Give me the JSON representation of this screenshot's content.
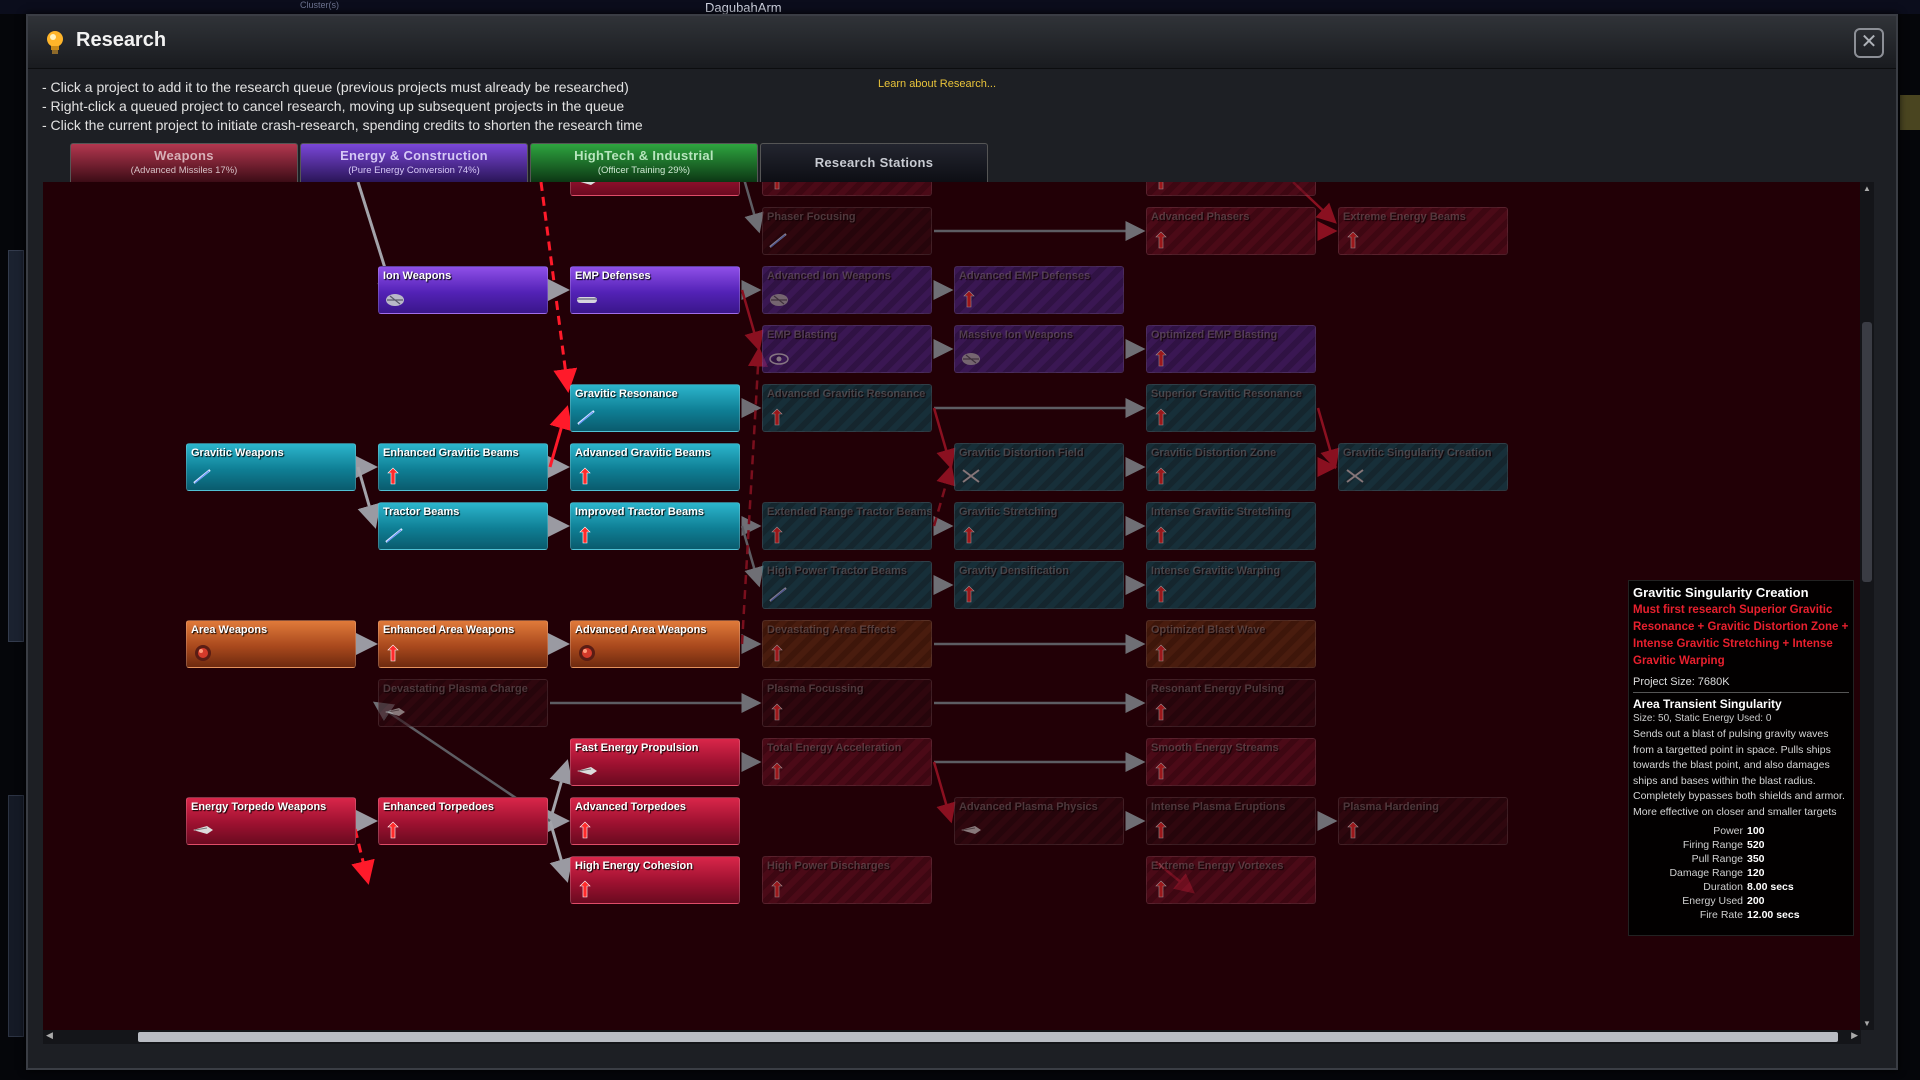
{
  "background": {
    "label_a": "Cluster(s)",
    "label_b": "DagubahArm"
  },
  "window": {
    "title": "Research",
    "close_glyph": "✕"
  },
  "instructions": [
    "- Click a project to add it to the research queue (previous projects must already be researched)",
    "- Right-click a queued project to cancel research, moving up subsequent projects in the queue",
    "- Click the current project to initiate crash-research, spending credits to shorten the research time"
  ],
  "learn_link": "Learn about Research...",
  "tabs": [
    {
      "label": "Weapons",
      "sub": "(Advanced Missiles 17%)"
    },
    {
      "label": "Energy & Construction",
      "sub": "(Pure Energy Conversion 74%)"
    },
    {
      "label": "HighTech & Industrial",
      "sub": "(Officer Training 29%)"
    },
    {
      "label": "Research Stations",
      "sub": ""
    }
  ],
  "nodes": [
    {
      "id": "top-red",
      "label": "",
      "color": "red",
      "state": "active",
      "icon": "torpedo-icon"
    },
    {
      "id": "top-col3",
      "label": "",
      "color": "red",
      "state": "locked",
      "icon": "arrow-icon"
    },
    {
      "id": "top-col5",
      "label": "",
      "color": "red",
      "state": "locked",
      "icon": "arrow-icon"
    },
    {
      "id": "phaser-focusing",
      "label": "Phaser Focusing",
      "color": "dark",
      "state": "locked",
      "icon": "beam-icon"
    },
    {
      "id": "advanced-phasers",
      "label": "Advanced Phasers",
      "color": "red",
      "state": "locked",
      "icon": "arrow-icon"
    },
    {
      "id": "extreme-energy-beams",
      "label": "Extreme Energy Beams",
      "color": "red",
      "state": "locked",
      "icon": "arrow-icon"
    },
    {
      "id": "ion-weapons",
      "label": "Ion Weapons",
      "color": "purple",
      "state": "active",
      "icon": "ion-icon"
    },
    {
      "id": "emp-defenses",
      "label": "EMP Defenses",
      "color": "purple",
      "state": "active",
      "icon": "emp-icon"
    },
    {
      "id": "advanced-ion-weapons",
      "label": "Advanced Ion Weapons",
      "color": "purple",
      "state": "locked",
      "icon": "ion-icon"
    },
    {
      "id": "advanced-emp-defenses",
      "label": "Advanced EMP Defenses",
      "color": "purple",
      "state": "locked",
      "icon": "arrow-icon"
    },
    {
      "id": "emp-blasting",
      "label": "EMP Blasting",
      "color": "purple",
      "state": "locked",
      "icon": "blast-icon"
    },
    {
      "id": "massive-ion-weapons",
      "label": "Massive Ion Weapons",
      "color": "purple",
      "state": "locked",
      "icon": "ion-icon"
    },
    {
      "id": "optimized-emp-blasting",
      "label": "Optimized EMP Blasting",
      "color": "purple",
      "state": "locked",
      "icon": "arrow-icon"
    },
    {
      "id": "gravitic-resonance",
      "label": "Gravitic Resonance",
      "color": "teal",
      "state": "active",
      "icon": "beam-icon"
    },
    {
      "id": "advanced-gravitic-resonance",
      "label": "Advanced Gravitic Resonance",
      "color": "teal",
      "state": "locked",
      "icon": "arrow-icon"
    },
    {
      "id": "superior-gravitic-resonance",
      "label": "Superior Gravitic Resonance",
      "color": "teal",
      "state": "locked",
      "icon": "arrow-icon"
    },
    {
      "id": "gravitic-weapons",
      "label": "Gravitic Weapons",
      "color": "teal",
      "state": "active",
      "icon": "beam-icon"
    },
    {
      "id": "enhanced-gravitic-beams",
      "label": "Enhanced Gravitic Beams",
      "color": "teal",
      "state": "active",
      "icon": "arrow-icon"
    },
    {
      "id": "advanced-gravitic-beams",
      "label": "Advanced Gravitic Beams",
      "color": "teal",
      "state": "active",
      "icon": "arrow-icon"
    },
    {
      "id": "gravitic-distortion-field",
      "label": "Gravitic Distortion Field",
      "color": "teal",
      "state": "locked",
      "icon": "cross-icon"
    },
    {
      "id": "gravitic-distortion-zone",
      "label": "Gravitic Distortion Zone",
      "color": "teal",
      "state": "locked",
      "icon": "arrow-icon"
    },
    {
      "id": "gravitic-singularity-creation",
      "label": "Gravitic Singularity Creation",
      "color": "teal",
      "state": "locked",
      "icon": "cross-icon"
    },
    {
      "id": "tractor-beams",
      "label": "Tractor Beams",
      "color": "teal",
      "state": "active",
      "icon": "beam-icon"
    },
    {
      "id": "improved-tractor-beams",
      "label": "Improved Tractor Beams",
      "color": "teal",
      "state": "active",
      "icon": "arrow-icon"
    },
    {
      "id": "extended-range-tractor-beams",
      "label": "Extended Range Tractor Beams",
      "color": "teal",
      "state": "locked",
      "icon": "arrow-icon"
    },
    {
      "id": "gravitic-stretching",
      "label": "Gravitic Stretching",
      "color": "teal",
      "state": "locked",
      "icon": "arrow-icon"
    },
    {
      "id": "intense-gravitic-stretching",
      "label": "Intense Gravitic Stretching",
      "color": "teal",
      "state": "locked",
      "icon": "arrow-icon"
    },
    {
      "id": "high-power-tractor-beams",
      "label": "High Power Tractor Beams",
      "color": "teal",
      "state": "locked",
      "icon": "beam-icon"
    },
    {
      "id": "gravity-densification",
      "label": "Gravity Densification",
      "color": "teal",
      "state": "locked",
      "icon": "arrow-icon"
    },
    {
      "id": "intense-gravitic-warping",
      "label": "Intense Gravitic Warping",
      "color": "teal",
      "state": "locked",
      "icon": "arrow-icon"
    },
    {
      "id": "area-weapons",
      "label": "Area Weapons",
      "color": "orange",
      "state": "active",
      "icon": "area-icon"
    },
    {
      "id": "enhanced-area-weapons",
      "label": "Enhanced Area Weapons",
      "color": "orange",
      "state": "active",
      "icon": "arrow-icon"
    },
    {
      "id": "advanced-area-weapons",
      "label": "Advanced Area Weapons",
      "color": "orange",
      "state": "active",
      "icon": "area-icon"
    },
    {
      "id": "devastating-area-effects",
      "label": "Devastating Area Effects",
      "color": "orange",
      "state": "locked",
      "icon": "arrow-icon"
    },
    {
      "id": "optimized-blast-wave",
      "label": "Optimized Blast Wave",
      "color": "orange",
      "state": "locked",
      "icon": "arrow-icon"
    },
    {
      "id": "devastating-plasma-charge",
      "label": "Devastating Plasma Charge",
      "color": "dark",
      "state": "locked",
      "icon": "torpedo-icon"
    },
    {
      "id": "plasma-focussing",
      "label": "Plasma Focussing",
      "color": "dark",
      "state": "locked",
      "icon": "arrow-icon"
    },
    {
      "id": "resonant-energy-pulsing",
      "label": "Resonant Energy Pulsing",
      "color": "dark",
      "state": "locked",
      "icon": "arrow-icon"
    },
    {
      "id": "fast-energy-propulsion",
      "label": "Fast Energy Propulsion",
      "color": "red",
      "state": "active",
      "icon": "torpedo-icon"
    },
    {
      "id": "total-energy-acceleration",
      "label": "Total Energy Acceleration",
      "color": "red",
      "state": "locked",
      "icon": "arrow-icon"
    },
    {
      "id": "smooth-energy-streams",
      "label": "Smooth Energy Streams",
      "color": "red",
      "state": "locked",
      "icon": "arrow-icon"
    },
    {
      "id": "energy-torpedo-weapons",
      "label": "Energy Torpedo Weapons",
      "color": "red",
      "state": "active",
      "icon": "torpedo-icon"
    },
    {
      "id": "enhanced-torpedoes",
      "label": "Enhanced Torpedoes",
      "color": "red",
      "state": "active",
      "icon": "arrow-icon"
    },
    {
      "id": "advanced-torpedoes",
      "label": "Advanced Torpedoes",
      "color": "red",
      "state": "active",
      "icon": "arrow-icon"
    },
    {
      "id": "advanced-plasma-physics",
      "label": "Advanced Plasma Physics",
      "color": "dark",
      "state": "locked",
      "icon": "torpedo-icon"
    },
    {
      "id": "intense-plasma-eruptions",
      "label": "Intense Plasma Eruptions",
      "color": "dark",
      "state": "locked",
      "icon": "arrow-icon"
    },
    {
      "id": "plasma-hardening",
      "label": "Plasma Hardening",
      "color": "dark",
      "state": "locked",
      "icon": "arrow-icon"
    },
    {
      "id": "high-energy-cohesion",
      "label": "High Energy Cohesion",
      "color": "red",
      "state": "active",
      "icon": "arrow-icon"
    },
    {
      "id": "high-power-discharges",
      "label": "High Power Discharges",
      "color": "red",
      "state": "locked",
      "icon": "arrow-icon"
    },
    {
      "id": "extreme-energy-vortexes",
      "label": "Extreme Energy Vortexes",
      "color": "red",
      "state": "locked",
      "icon": "arrow-icon"
    }
  ],
  "tooltip": {
    "title": "Gravitic Singularity Creation",
    "requirement": "Must first research Superior Gravitic Resonance + Gravitic Distortion Zone + Intense Gravitic Stretching + Intense Gravitic Warping",
    "project_size": "Project Size: 7680K",
    "component_name": "Area Transient Singularity",
    "component_sub": "Size: 50,  Static Energy Used: 0",
    "description": "Sends out a blast of pulsing gravity waves from a targetted point in space. Pulls ships towards the blast point, and also damages ships and bases within the blast radius. Completely bypasses both shields and armor. More effective on closer and smaller targets",
    "stats": [
      {
        "k": "Power",
        "v": "100"
      },
      {
        "k": "Firing Range",
        "v": "520"
      },
      {
        "k": "Pull Range",
        "v": "350"
      },
      {
        "k": "Damage Range",
        "v": "120"
      },
      {
        "k": "Duration",
        "v": "8.00 secs"
      },
      {
        "k": "Energy Used",
        "v": "200"
      },
      {
        "k": "Fire Rate",
        "v": "12.00 secs"
      }
    ]
  },
  "scroll": {
    "up": "▲",
    "down": "▼",
    "left": "◀",
    "right": "▶"
  }
}
